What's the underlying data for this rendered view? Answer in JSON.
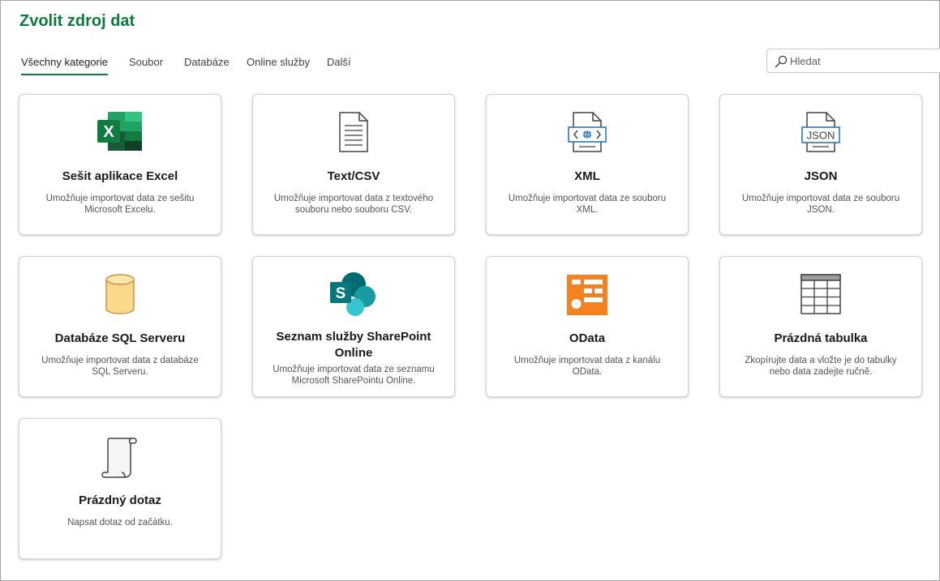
{
  "header": {
    "title": "Zvolit zdroj dat"
  },
  "tabs": [
    {
      "label": "Všechny kategorie",
      "active": true
    },
    {
      "label": "Soubor"
    },
    {
      "label": "Databáze"
    },
    {
      "label": "Online služby"
    },
    {
      "label": "Další"
    }
  ],
  "search": {
    "placeholder": "Hledat"
  },
  "cards": [
    {
      "name": "Sešit aplikace Excel",
      "description": "Umožňuje importovat data ze sešitu Microsoft Excelu.",
      "icon": "excel-icon"
    },
    {
      "name": "Text/CSV",
      "description": "Umožňuje importovat data z textového souboru nebo souboru CSV.",
      "icon": "text-file-icon"
    },
    {
      "name": "XML",
      "description": "Umožňuje importovat data ze souboru XML.",
      "icon": "xml-file-icon"
    },
    {
      "name": "JSON",
      "description": "Umožňuje importovat data ze souboru JSON.",
      "icon": "json-file-icon"
    },
    {
      "name": "Databáze SQL Serveru",
      "description": "Umožňuje importovat data z databáze SQL Serveru.",
      "icon": "database-icon"
    },
    {
      "name": "Seznam služby SharePoint Online",
      "description": "Umožňuje importovat data ze seznamu Microsoft SharePointu Online.",
      "icon": "sharepoint-icon"
    },
    {
      "name": "OData",
      "description": "Umožňuje importovat data z kanálu OData.",
      "icon": "odata-icon"
    },
    {
      "name": "Prázdná tabulka",
      "description": "Zkopírujte data a vložte je do tabulky nebo data zadejte ručně.",
      "icon": "table-grid-icon"
    },
    {
      "name": "Prázdný dotaz",
      "description": "Napsat dotaz od začátku.",
      "icon": "blank-query-icon"
    }
  ],
  "icon_labels": {
    "excel": "X",
    "sharepoint": "S",
    "json": "JSON"
  },
  "colors": {
    "accent": "#0e7a3c",
    "excel_green": "#107c41",
    "odata_orange": "#f58220",
    "sharepoint_teal": "#038387",
    "sql_fill": "#fad98d"
  }
}
